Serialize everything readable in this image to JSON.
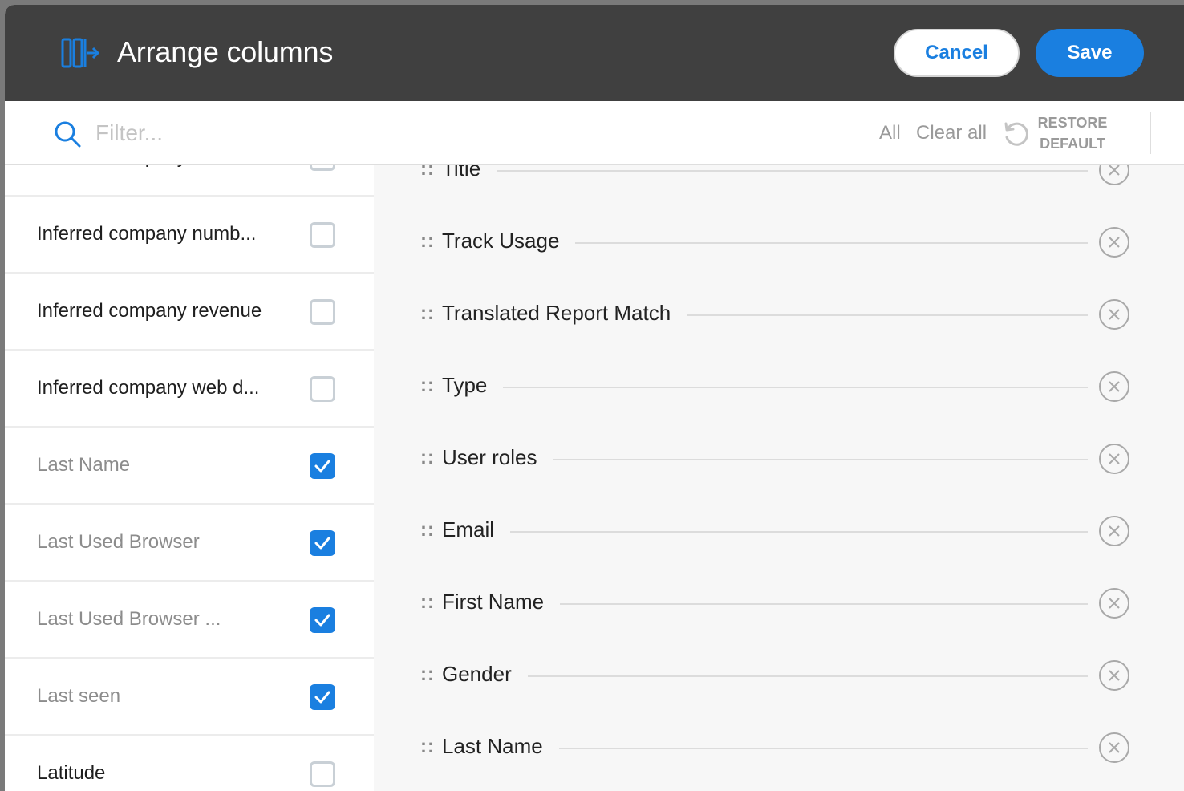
{
  "header": {
    "title": "Arrange columns",
    "icon": "arrange-columns-icon",
    "cancel_label": "Cancel",
    "save_label": "Save"
  },
  "filter": {
    "placeholder": "Filter...",
    "all_label": "All",
    "clear_all_label": "Clear all",
    "restore_label_line1": "RESTORE",
    "restore_label_line2": "DEFAULT"
  },
  "available_columns": [
    {
      "label": "Inferred company name",
      "checked": false
    },
    {
      "label": "Inferred company numb...",
      "checked": false
    },
    {
      "label": "Inferred company revenue",
      "checked": false
    },
    {
      "label": "Inferred company web d...",
      "checked": false
    },
    {
      "label": "Last Name",
      "checked": true
    },
    {
      "label": "Last Used Browser",
      "checked": true
    },
    {
      "label": "Last Used Browser ...",
      "checked": true
    },
    {
      "label": "Last seen",
      "checked": true
    },
    {
      "label": "Latitude",
      "checked": false
    }
  ],
  "selected_columns": [
    {
      "label": "Title"
    },
    {
      "label": "Track Usage"
    },
    {
      "label": "Translated Report Match"
    },
    {
      "label": "Type"
    },
    {
      "label": "User roles"
    },
    {
      "label": "Email"
    },
    {
      "label": "First Name"
    },
    {
      "label": "Gender"
    },
    {
      "label": "Last Name"
    }
  ],
  "grip_symbol": "::",
  "colors": {
    "accent": "#1a7fe0",
    "header_bg": "#404040"
  }
}
